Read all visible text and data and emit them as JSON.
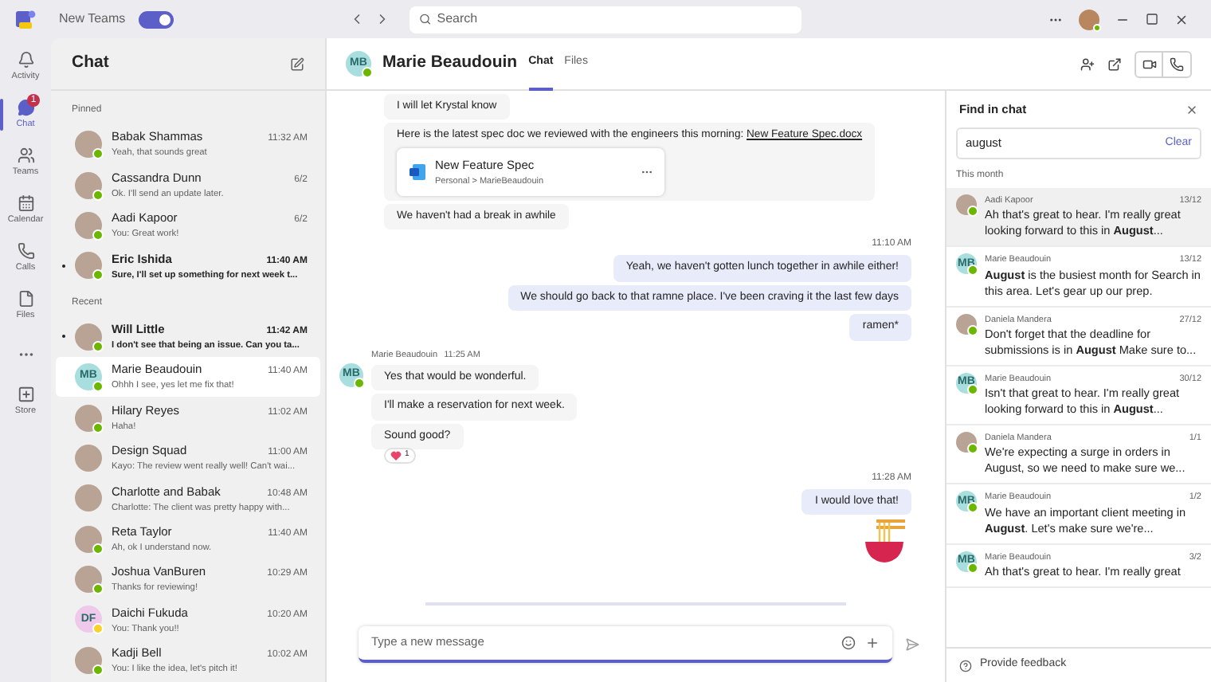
{
  "titlebar": {
    "toggle_label": "New Teams",
    "toggle_on": true,
    "search_placeholder": "Search"
  },
  "rail": [
    {
      "kind": "activity",
      "label": "Activity",
      "selected": false
    },
    {
      "kind": "chat",
      "label": "Chat",
      "selected": true,
      "badge": "1"
    },
    {
      "kind": "teams",
      "label": "Teams",
      "selected": false
    },
    {
      "kind": "calendar",
      "label": "Calendar",
      "selected": false
    },
    {
      "kind": "calls",
      "label": "Calls",
      "selected": false
    },
    {
      "kind": "files",
      "label": "Files",
      "selected": false
    },
    {
      "kind": "more",
      "selected": false
    },
    {
      "kind": "store",
      "label": "Store",
      "selected": false
    }
  ],
  "chat_list": {
    "title": "Chat",
    "sections": [
      {
        "title": "Pinned",
        "items": [
          {
            "name": "Babak Shammas",
            "preview": "Yeah, that sounds great",
            "time": "11:32 AM",
            "unread": false,
            "selected": false,
            "color": "#6bb700",
            "avatar": {
              "kind": "photo"
            }
          },
          {
            "name": "Cassandra Dunn",
            "preview": "Ok. I'll send an update later.",
            "time": "6/2",
            "unread": false,
            "selected": false,
            "color": "#6bb700",
            "avatar": {
              "kind": "photo"
            }
          },
          {
            "name": "Aadi Kapoor",
            "preview": "You: Great work!",
            "time": "6/2",
            "unread": false,
            "selected": false,
            "color": "#6bb700",
            "avatar": {
              "kind": "photo"
            }
          },
          {
            "name": "Eric Ishida",
            "preview": "Sure, I'll set up something for next week t...",
            "time": "11:40 AM",
            "unread": true,
            "selected": false,
            "color": "#6bb700",
            "avatar": {
              "kind": "photo"
            }
          }
        ]
      },
      {
        "title": "Recent",
        "items": [
          {
            "name": "Will Little",
            "preview": "I don't see that being an issue. Can you ta...",
            "time": "11:42 AM",
            "unread": true,
            "selected": false,
            "color": "#6bb700",
            "avatar": {
              "kind": "photo"
            }
          },
          {
            "name": "Marie Beaudouin",
            "preview": "Ohhh I see, yes let me fix that!",
            "time": "11:40 AM",
            "unread": false,
            "selected": true,
            "color": "#6bb700",
            "avatar": {
              "kind": "initials",
              "initials": "MB",
              "color": "#a8dede"
            }
          },
          {
            "name": "Hilary Reyes",
            "preview": "Haha!",
            "time": "11:02 AM",
            "unread": false,
            "selected": false,
            "color": "#6bb700",
            "avatar": {
              "kind": "photo"
            }
          },
          {
            "name": "Design Squad",
            "preview": "Kayo: The review went really well! Can't wai...",
            "time": "11:00 AM",
            "unread": false,
            "selected": false,
            "avatar": {
              "kind": "photo"
            }
          },
          {
            "name": "Charlotte and Babak",
            "preview": "Charlotte: The client was pretty happy with...",
            "time": "10:48 AM",
            "unread": false,
            "selected": false,
            "avatar": {
              "kind": "photo"
            }
          },
          {
            "name": "Reta Taylor",
            "preview": "Ah, ok I understand now.",
            "time": "11:40 AM",
            "unread": false,
            "selected": false,
            "color": "#6bb700",
            "avatar": {
              "kind": "photo"
            }
          },
          {
            "name": "Joshua VanBuren",
            "preview": "Thanks for reviewing!",
            "time": "10:29 AM",
            "unread": false,
            "selected": false,
            "color": "#6bb700",
            "avatar": {
              "kind": "photo"
            }
          },
          {
            "name": "Daichi Fukuda",
            "preview": "You: Thank you!!",
            "time": "10:20 AM",
            "unread": false,
            "selected": false,
            "color": "#f8d22a",
            "avatar": {
              "kind": "initials",
              "initials": "DF",
              "color": "#efc9ea"
            }
          },
          {
            "name": "Kadji Bell",
            "preview": "You: I like the idea, let's pitch it!",
            "time": "10:02 AM",
            "unread": false,
            "selected": false,
            "color": "#6bb700",
            "avatar": {
              "kind": "photo"
            }
          }
        ]
      }
    ]
  },
  "conversation": {
    "name": "Marie Beaudouin",
    "initials": "MB",
    "color": "#6bb700",
    "tabs": [
      {
        "label": "Chat",
        "selected": true
      },
      {
        "label": "Files",
        "selected": false
      }
    ],
    "messages": [
      {
        "kind": "received",
        "text": "I will let Krystal know"
      },
      {
        "kind": "received",
        "text": "Here is the latest spec doc we reviewed with the engineers this morning:",
        "link": "New Feature Spec.docx",
        "file": {
          "name": "New Feature Spec",
          "path": "Personal > MarieBeaudouin"
        }
      },
      {
        "kind": "received",
        "text": "We haven't had a break in awhile"
      },
      {
        "kind": "time",
        "text": "11:10 AM"
      },
      {
        "kind": "sent",
        "text": "Yeah, we haven't gotten lunch together in awhile either!"
      },
      {
        "kind": "sent",
        "text": "We should go back to that ramne place. I've been craving it the last few days"
      },
      {
        "kind": "sent",
        "text": "ramen*"
      },
      {
        "kind": "group",
        "name": "Marie Beaudouin",
        "time": "11:25 AM",
        "initials": "MB",
        "color": "#6bb700",
        "messages": [
          {
            "text": "Yes that would be wonderful."
          },
          {
            "text": "I'll make a reservation for next week."
          },
          {
            "text": "Sound good?",
            "reaction": "1"
          }
        ]
      },
      {
        "kind": "time",
        "text": "11:28 AM"
      },
      {
        "kind": "sent",
        "text": "I would love that!"
      },
      {
        "kind": "sticker"
      }
    ],
    "composer_placeholder": "Type a new message"
  },
  "find_panel": {
    "title": "Find in chat",
    "query": "august",
    "clear_label": "Clear",
    "section": "This month",
    "results": [
      {
        "name": "Aadi Kapoor",
        "date": "13/12",
        "text": "Ah that's great to hear. I'm really great looking forward to this in **August**...",
        "selected": true,
        "color": "#6bb700",
        "avatar": {
          "kind": "photo"
        }
      },
      {
        "name": "Marie Beaudouin",
        "date": "13/12",
        "text": "**August** is the busiest month for Search in this area. Let's gear up our prep.",
        "selected": false,
        "color": "#6bb700",
        "avatar": {
          "kind": "initials",
          "initials": "MB",
          "color": "#a8dede"
        }
      },
      {
        "name": "Daniela Mandera",
        "date": "27/12",
        "text": "Don't forget that the deadline for submissions is in **August** Make sure to...",
        "selected": false,
        "color": "#6bb700",
        "avatar": {
          "kind": "photo"
        }
      },
      {
        "name": "Marie Beaudouin",
        "date": "30/12",
        "text": "Isn't that great to hear. I'm really great looking forward to this in **August**...",
        "selected": false,
        "color": "#6bb700",
        "avatar": {
          "kind": "initials",
          "initials": "MB",
          "color": "#a8dede"
        }
      },
      {
        "name": "Daniela Mandera",
        "date": "1/1",
        "text": "We're expecting a surge in orders in August, so we need to make sure we...",
        "selected": false,
        "color": "#6bb700",
        "avatar": {
          "kind": "photo"
        }
      },
      {
        "name": "Marie Beaudouin",
        "date": "1/2",
        "text": "We have an important client meeting in **August**. Let's make sure we're...",
        "selected": false,
        "color": "#6bb700",
        "avatar": {
          "kind": "initials",
          "initials": "MB",
          "color": "#a8dede"
        }
      },
      {
        "name": "Marie Beaudouin",
        "date": "3/2",
        "text": "Ah that's great to hear. I'm really great",
        "selected": false,
        "color": "#6bb700",
        "avatar": {
          "kind": "initials",
          "initials": "MB",
          "color": "#a8dede"
        }
      }
    ],
    "feedback": "Provide feedback"
  }
}
